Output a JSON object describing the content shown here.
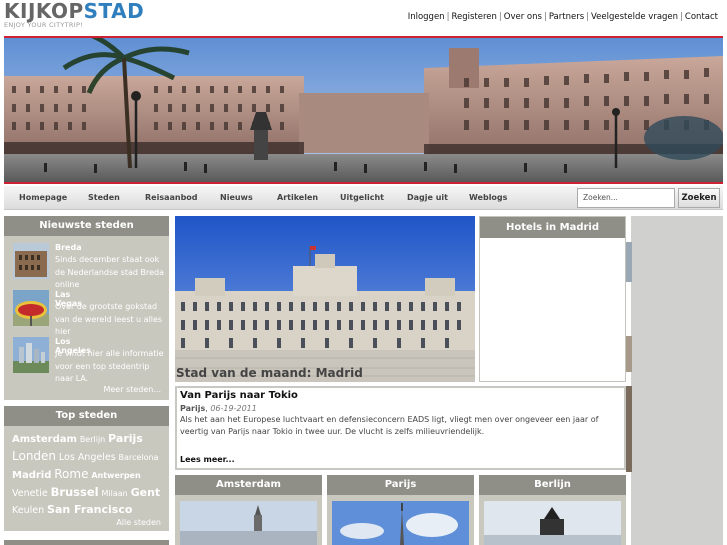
{
  "header": {
    "logo_part1": "KIJKOP",
    "logo_part2": "STAD",
    "tagline": "ENJOY YOUR CITYTRIP!",
    "links": [
      "Inloggen",
      "Registeren",
      "Over ons",
      "Partners",
      "Veelgestelde vragen",
      "Contact"
    ]
  },
  "nav": {
    "items": [
      "Homepage",
      "Steden",
      "Reisaanbod",
      "Nieuws",
      "Artikelen",
      "Uitgelicht",
      "Dagje uit",
      "Weblogs"
    ],
    "search_placeholder": "Zoeken...",
    "search_button": "Zoeken"
  },
  "sidebar": {
    "newest": {
      "title": "Nieuwste steden",
      "items": [
        {
          "name": "Breda",
          "desc": "Sinds december staat ook de Nederlandse stad Breda online"
        },
        {
          "name": "Las Vegas",
          "desc": "Over de grootste gokstad van de wereld leest u alles hier"
        },
        {
          "name": "Los Angeles",
          "desc": "Je vindt hier alle informatie voor een top stedentrip naar LA."
        }
      ],
      "more": "Meer steden..."
    },
    "top": {
      "title": "Top steden",
      "tags": [
        "Amsterdam",
        "Berlijn",
        "Parijs",
        "Londen",
        "Los Angeles",
        "Barcelona",
        "Madrid",
        "Rome",
        "Antwerpen",
        "Venetie",
        "Brussel",
        "Milaan",
        "Gent",
        "Keulen",
        "San Francisco"
      ],
      "more": "Alle steden"
    }
  },
  "feature": {
    "caption": "Stad van de maand: Madrid"
  },
  "hotels": {
    "title": "Hotels in Madrid"
  },
  "article": {
    "title": "Van Parijs naar Tokio",
    "city": "Parijs",
    "date": "06-19-2011",
    "body": "Als het aan het Europese luchtvaart en defensieconcern EADS ligt, vliegt men over ongeveer een jaar of veertig van Parijs naar Tokio in twee uur. De vlucht is zelfs milieuvriendelijk.",
    "more": "Lees meer..."
  },
  "cities": [
    "Amsterdam",
    "Parijs",
    "Berlijn"
  ],
  "colors": {
    "brand_blue": "#2f7fbe",
    "banner_border": "#cc2233",
    "box_header": "#8f8f88",
    "box_bg": "#c8c8bf"
  }
}
